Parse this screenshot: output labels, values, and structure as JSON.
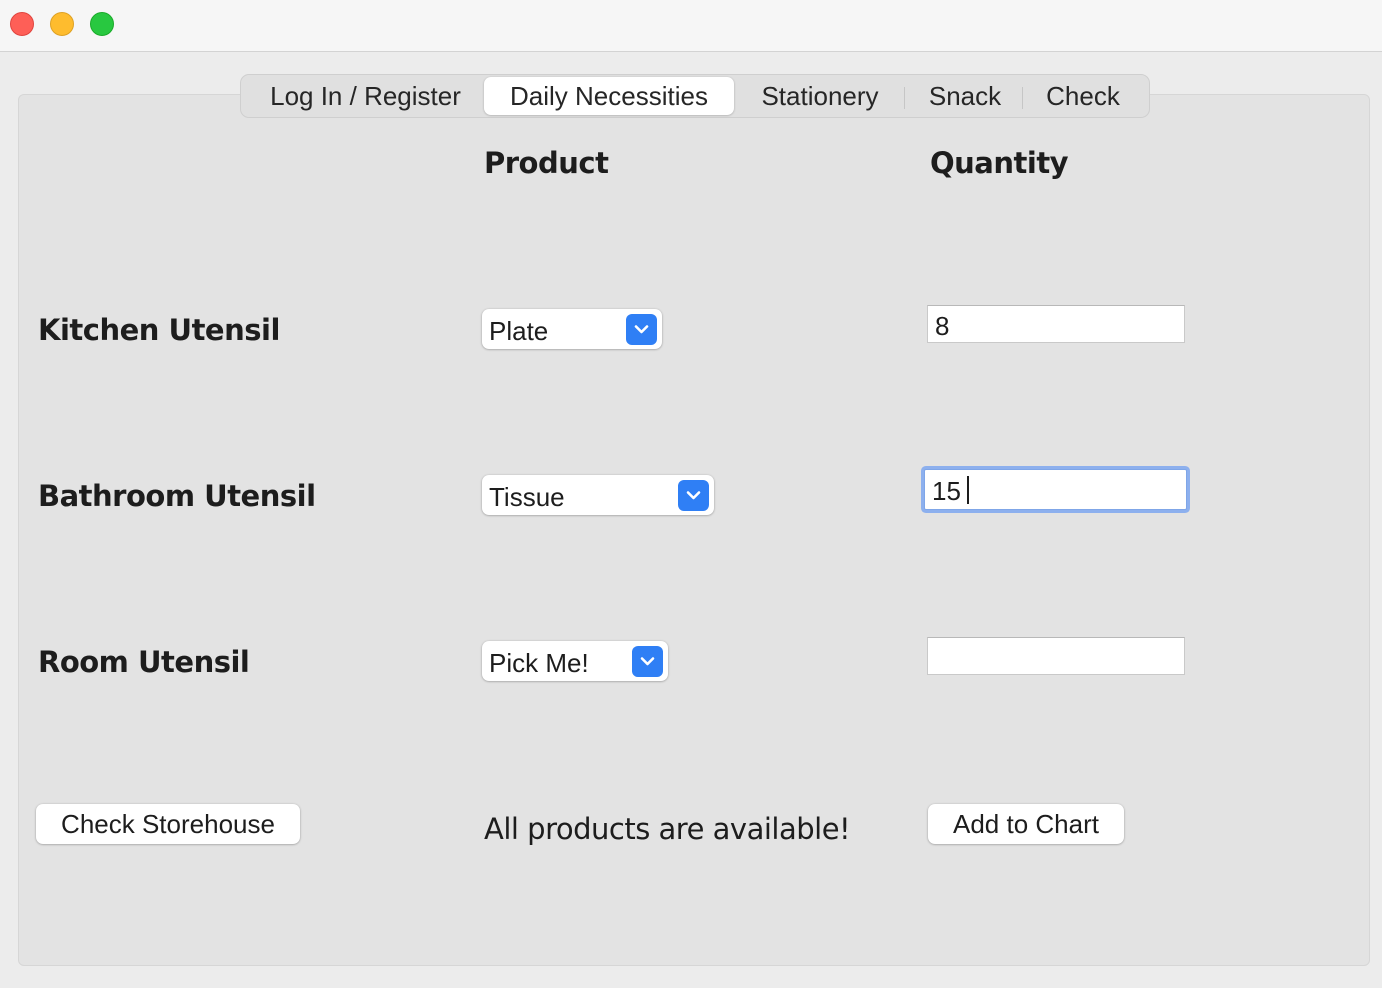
{
  "window": {
    "controls": [
      "close",
      "minimize",
      "maximize"
    ]
  },
  "tabs": [
    {
      "label": "Log In / Register",
      "active": false
    },
    {
      "label": "Daily Necessities",
      "active": true
    },
    {
      "label": "Stationery",
      "active": false
    },
    {
      "label": "Snack",
      "active": false
    },
    {
      "label": "Check",
      "active": false
    }
  ],
  "headers": {
    "product": "Product",
    "quantity": "Quantity"
  },
  "rows": [
    {
      "category": "Kitchen Utensil",
      "product": "Plate",
      "quantity": "8"
    },
    {
      "category": "Bathroom Utensil",
      "product": "Tissue",
      "quantity": "15"
    },
    {
      "category": "Room Utensil",
      "product": "Pick Me!",
      "quantity": ""
    }
  ],
  "actions": {
    "check_storehouse": "Check Storehouse",
    "status_message": "All products are available!",
    "add_to_chart": "Add to Chart"
  },
  "colors": {
    "accent": "#2f7ff5",
    "focus_ring": "#8db0ee",
    "close": "#fe5f57",
    "minimize": "#febc2e",
    "maximize": "#28c840"
  },
  "icons": {
    "popup_indicator": "chevron-down-icon"
  }
}
